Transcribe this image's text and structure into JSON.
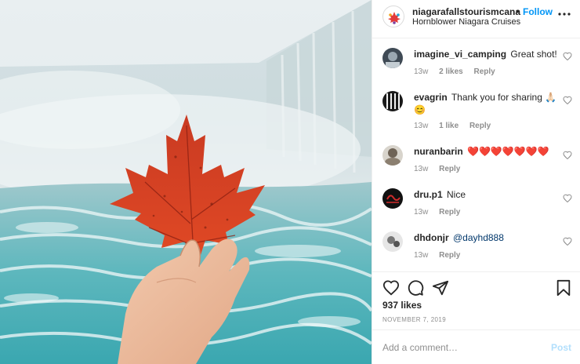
{
  "post": {
    "image_alt": "hand holding a red maple leaf in front of a waterfall"
  },
  "header": {
    "username": "niagarafallstourismcana",
    "separator": "•",
    "follow_label": "Follow",
    "location": "Hornblower Niagara Cruises",
    "more_icon": "more-options-icon"
  },
  "comments": [
    {
      "username": "imagine_vi_camping",
      "text": "Great shot!",
      "age": "13w",
      "likes": "2 likes",
      "reply": "Reply"
    },
    {
      "username": "evagrin",
      "text": "Thank you for sharing 🙏🏻 😊",
      "age": "13w",
      "likes": "1 like",
      "reply": "Reply"
    },
    {
      "username": "nuranbarin",
      "text": "❤️❤️❤️❤️❤️❤️❤️",
      "age": "13w",
      "likes": "",
      "reply": "Reply"
    },
    {
      "username": "dru.p1",
      "text": "Nice",
      "age": "13w",
      "likes": "",
      "reply": "Reply"
    },
    {
      "username": "dhdonjr",
      "text": "@dayhd888",
      "age": "13w",
      "likes": "",
      "reply": "Reply"
    }
  ],
  "actions": {
    "icons": [
      "heart-icon",
      "comment-icon",
      "share-icon",
      "bookmark-icon"
    ],
    "likes_count": "937 likes",
    "date": "NOVEMBER 7, 2019"
  },
  "add_comment": {
    "placeholder": "Add a comment…",
    "post_label": "Post"
  },
  "colors": {
    "follow_blue": "#0095f6",
    "post_disabled_blue": "#b2dffc",
    "heart_red": "#ed4956",
    "leaf_red": "#d9361e"
  }
}
